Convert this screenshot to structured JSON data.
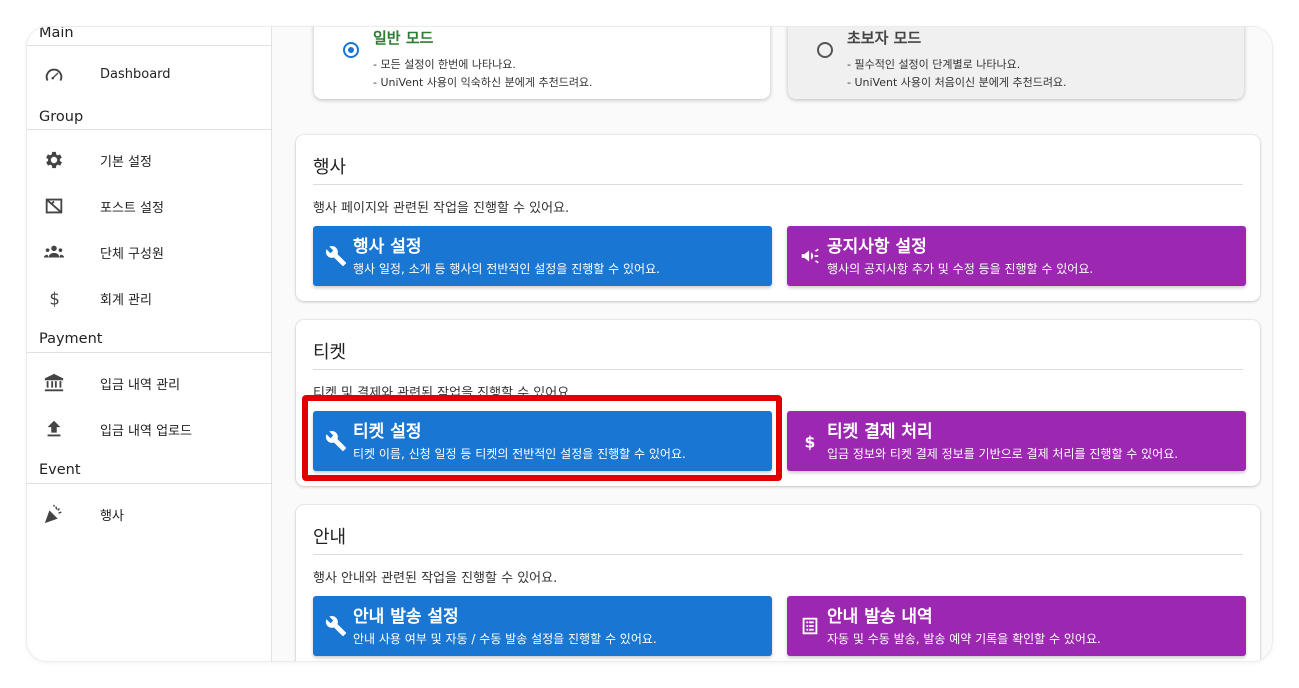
{
  "sidebar": {
    "sections": {
      "main": "Main",
      "group": "Group",
      "payment": "Payment",
      "event": "Event"
    },
    "items": {
      "dashboard": {
        "label": "Dashboard",
        "icon": "speedometer-icon"
      },
      "basic_settings": {
        "label": "기본 설정",
        "icon": "gear-icon"
      },
      "post_settings": {
        "label": "포스트 설정",
        "icon": "post-icon"
      },
      "members": {
        "label": "단체 구성원",
        "icon": "group-icon"
      },
      "accounting": {
        "label": "회계 관리",
        "icon": "dollar-icon"
      },
      "deposit_manage": {
        "label": "입금 내역 관리",
        "icon": "bank-icon"
      },
      "deposit_upload": {
        "label": "입금 내역 업로드",
        "icon": "upload-icon"
      },
      "events": {
        "label": "행사",
        "icon": "party-popper-icon"
      }
    }
  },
  "modes": {
    "normal": {
      "title": "일반 모드",
      "line1": "- 모든 설정이 한번에 나타나요.",
      "line2": "- UniVent 사용이 익숙하신 분에게 추천드려요.",
      "selected": true
    },
    "beginner": {
      "title": "초보자 모드",
      "line1": "- 필수적인 설정이 단계별로 나타나요.",
      "line2": "- UniVent 사용이 처음이신 분에게 추천드려요.",
      "selected": false
    }
  },
  "panels": {
    "event": {
      "title": "행사",
      "desc": "행사 페이지와 관련된 작업을 진행할 수 있어요.",
      "left": {
        "title": "행사 설정",
        "sub": "행사 일정, 소개 등 행사의 전반적인 설정을 진행할 수 있어요.",
        "icon": "wrench-icon"
      },
      "right": {
        "title": "공지사항 설정",
        "sub": "행사의 공지사항 추가 및 수정 등을 진행할 수 있어요.",
        "icon": "megaphone-icon"
      }
    },
    "ticket": {
      "title": "티켓",
      "desc": "티켓 및 결제와 관련된 작업을 진행할 수 있어요.",
      "left": {
        "title": "티켓 설정",
        "sub": "티켓 이름, 신청 일정 등 티켓의 전반적인 설정을 진행할 수 있어요.",
        "icon": "wrench-icon"
      },
      "right": {
        "title": "티켓 결제 처리",
        "sub": "입금 정보와 티켓 결제 정보를 기반으로 결제 처리를 진행할 수 있어요.",
        "icon": "dollar-icon"
      }
    },
    "guide": {
      "title": "안내",
      "desc": "행사 안내와 관련된 작업을 진행할 수 있어요.",
      "left": {
        "title": "안내 발송 설정",
        "sub": "안내 사용 여부 및 자동 / 수동 발송 설정을 진행할 수 있어요.",
        "icon": "wrench-icon"
      },
      "right": {
        "title": "안내 발송 내역",
        "sub": "자동 및 수동 발송, 발송 예약 기록을 확인할 수 있어요.",
        "icon": "list-alt-icon"
      }
    }
  },
  "colors": {
    "primary": "#1976d2",
    "secondary": "#9c27b0",
    "normal_mode_title": "#2e7d32",
    "highlight": "#e00000"
  }
}
